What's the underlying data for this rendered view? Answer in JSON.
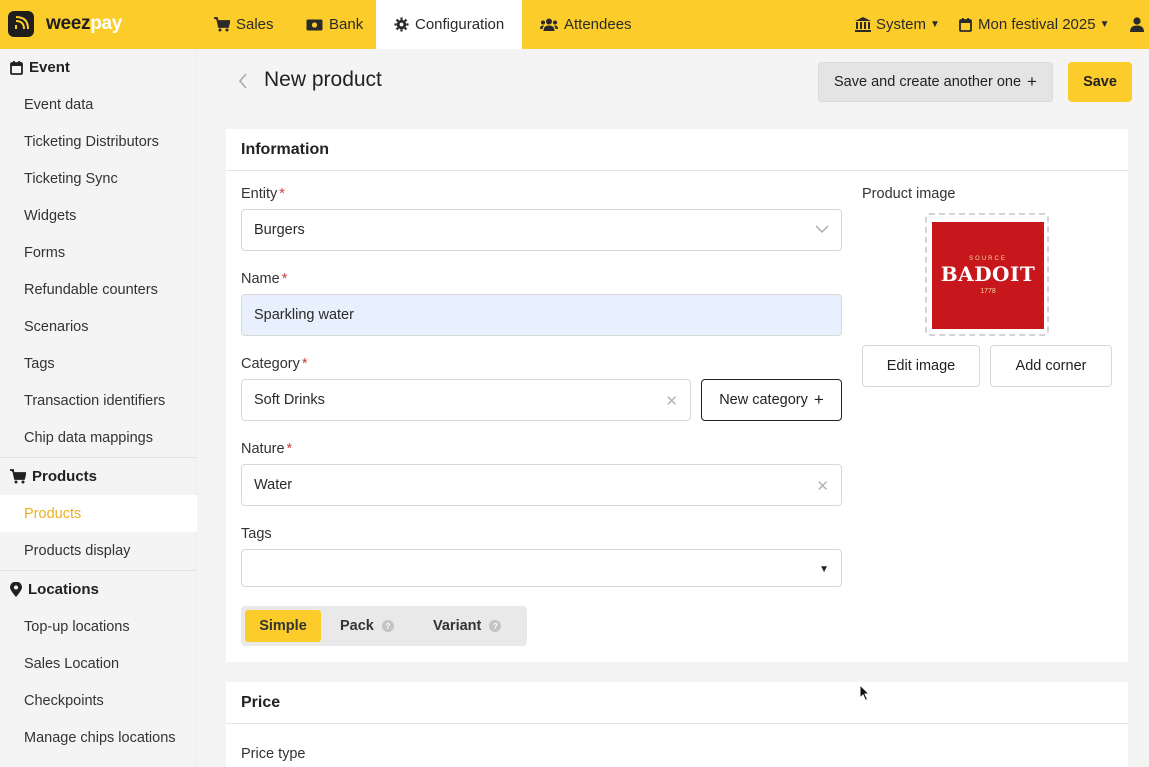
{
  "brand": {
    "name_a": "weez",
    "name_b": "pay"
  },
  "nav": {
    "tabs": [
      {
        "label": "Sales",
        "icon": "cart-icon"
      },
      {
        "label": "Bank",
        "icon": "money-icon"
      },
      {
        "label": "Configuration",
        "icon": "gear-icon",
        "active": true
      },
      {
        "label": "Attendees",
        "icon": "users-icon"
      }
    ],
    "system": "System",
    "festival": "Mon festival 2025"
  },
  "sidebar": {
    "sections": [
      {
        "title": "Event",
        "icon": "calendar-icon",
        "items": [
          "Event data",
          "Ticketing Distributors",
          "Ticketing Sync",
          "Widgets",
          "Forms",
          "Refundable counters",
          "Scenarios",
          "Tags",
          "Transaction identifiers",
          "Chip data mappings"
        ]
      },
      {
        "title": "Products",
        "icon": "cart-icon",
        "items": [
          "Products",
          "Products display"
        ],
        "active_item": "Products"
      },
      {
        "title": "Locations",
        "icon": "map-pin-icon",
        "items": [
          "Top-up locations",
          "Sales Location",
          "Checkpoints",
          "Manage chips locations"
        ]
      }
    ]
  },
  "page": {
    "title": "New product",
    "save_another_label": "Save and create another one",
    "save_label": "Save"
  },
  "info": {
    "title": "Information",
    "entity_label": "Entity",
    "entity_value": "Burgers",
    "name_label": "Name",
    "name_value": "Sparkling water",
    "category_label": "Category",
    "category_value": "Soft Drinks",
    "new_category_label": "New category",
    "nature_label": "Nature",
    "nature_value": "Water",
    "tags_label": "Tags",
    "tags_value": "",
    "required_mark": "*",
    "product_image_label": "Product image",
    "image_text": {
      "small": "SOURCE",
      "name": "BADOIT",
      "year": "1778"
    },
    "edit_image_label": "Edit image",
    "add_corner_label": "Add corner",
    "types": [
      {
        "label": "Simple",
        "active": true
      },
      {
        "label": "Pack",
        "help": "?"
      },
      {
        "label": "Variant",
        "help": "?"
      }
    ]
  },
  "price": {
    "title": "Price",
    "price_type_label": "Price type"
  },
  "colors": {
    "accent": "#fccd2a",
    "active_link": "#e9b21f",
    "required": "#d23b3b"
  }
}
